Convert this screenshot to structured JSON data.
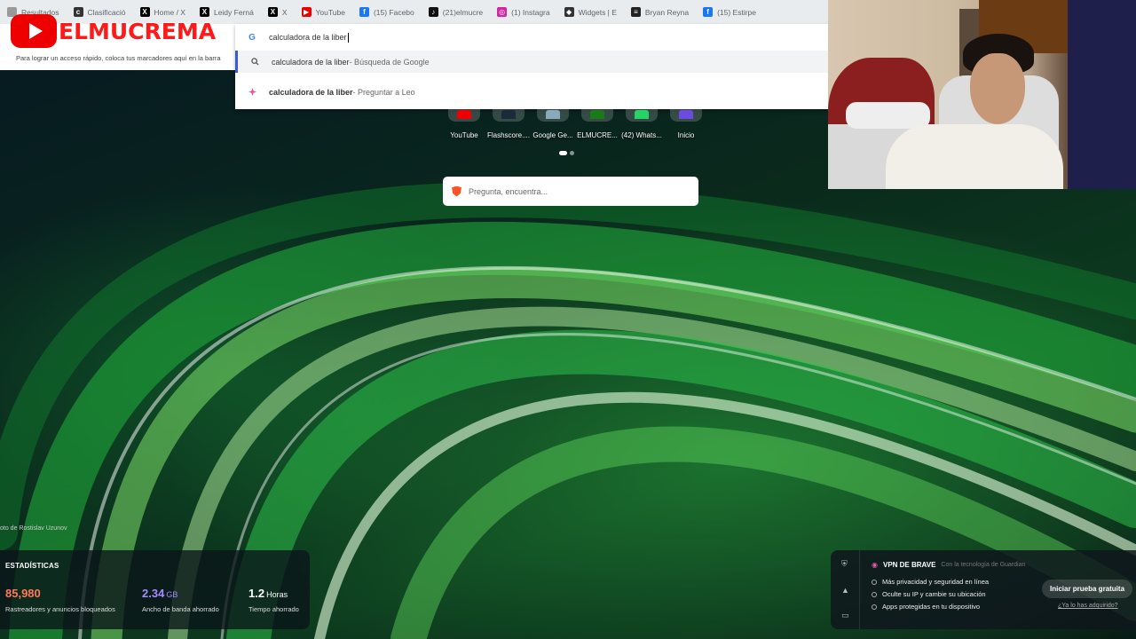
{
  "tabs": [
    {
      "label": "Resultados",
      "icon": "",
      "color": "#999"
    },
    {
      "label": "Clasificació",
      "icon": "c",
      "color": "#333"
    },
    {
      "label": "Home / X",
      "icon": "X",
      "color": "#000"
    },
    {
      "label": "Leidy Ferná",
      "icon": "X",
      "color": "#000"
    },
    {
      "label": "X",
      "icon": "X",
      "color": "#000"
    },
    {
      "label": "YouTube",
      "icon": "▶",
      "color": "#e00"
    },
    {
      "label": "(15) Facebo",
      "icon": "f",
      "color": "#1877f2"
    },
    {
      "label": "(21)elmucre",
      "icon": "♪",
      "color": "#111"
    },
    {
      "label": "(1) Instagra",
      "icon": "◎",
      "color": "#d6249f"
    },
    {
      "label": "Widgets | E",
      "icon": "◆",
      "color": "#333"
    },
    {
      "label": "Bryan Reyna",
      "icon": "≡",
      "color": "#222"
    },
    {
      "label": "(15) Estirpe",
      "icon": "f",
      "color": "#1877f2"
    }
  ],
  "logo": {
    "name": "ELMUCREMA"
  },
  "bookmarks": {
    "hint": "Para lograr un acceso rápido, coloca tus marcadores aquí en la barra"
  },
  "omnibox": {
    "query": "calculadora de la liber",
    "suggestions": [
      {
        "text": "calculadora de la liber",
        "suffix": " - Búsqueda de Google",
        "icon": "search-icon"
      },
      {
        "text": "calculadora de la liber",
        "suffix": " - Preguntar a Leo",
        "icon": "leo-icon"
      }
    ]
  },
  "shortcuts": [
    {
      "label": "YouTube",
      "color": "#e00"
    },
    {
      "label": "Flashscore....",
      "color": "#1b2b3a"
    },
    {
      "label": "Google Ge...",
      "color": "#8ab"
    },
    {
      "label": "ELMUCRE...",
      "color": "#1a7a1a"
    },
    {
      "label": "(42) Whats...",
      "color": "#25d366"
    },
    {
      "label": "Inicio",
      "color": "#6b4be0"
    }
  ],
  "search": {
    "placeholder": "Pregunta, encuentra..."
  },
  "photo_credit": "oto de Rostislav Uzunov",
  "stats": {
    "title": "ESTADÍSTICAS",
    "items": [
      {
        "value": "85,980",
        "unit": "",
        "desc": "Rastreadores y anuncios bloqueados",
        "color": "#ff7a59"
      },
      {
        "value": "2.34",
        "unit": "GB",
        "desc": "Ancho de banda ahorrado",
        "color": "#a58cff"
      },
      {
        "value": "1.2",
        "unit": "Horas",
        "desc": "Tiempo ahorrado",
        "color": "#ffffff"
      }
    ]
  },
  "vpn": {
    "title": "VPN DE BRAVE",
    "subtitle": "Con la tecnología de Guardian",
    "features": [
      "Más privacidad y seguridad en línea",
      "Oculte su IP y cambie su ubicación",
      "Apps protegidas en tu dispositivo"
    ],
    "cta": "Iniciar prueba gratuita",
    "already": "¿Ya lo has adquirido?"
  }
}
